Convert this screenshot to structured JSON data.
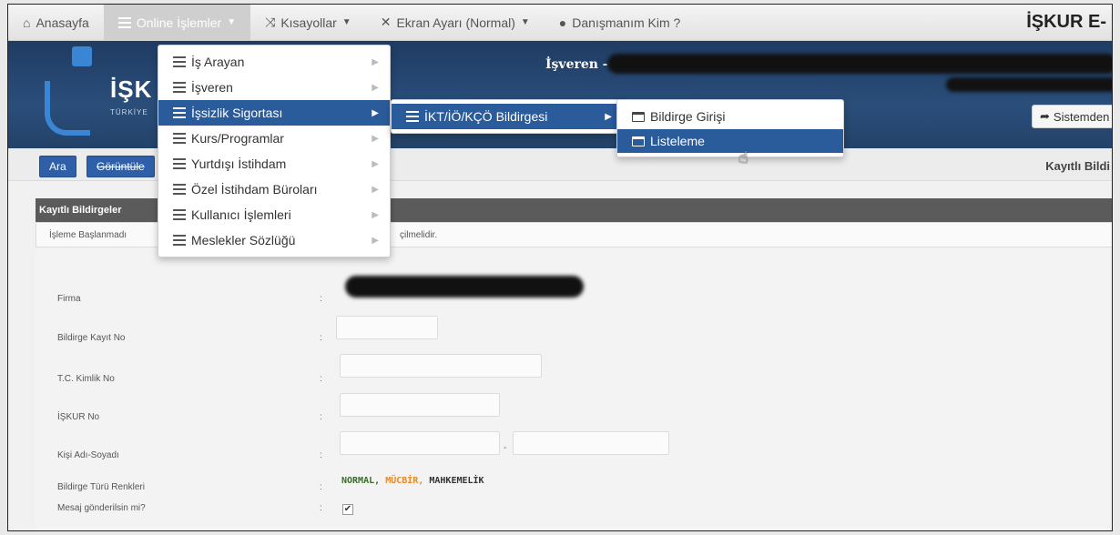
{
  "navbar": {
    "home_label": "Anasayfa",
    "online_label": "Online İşlemler",
    "shortcuts_label": "Kısayollar",
    "screen_label": "Ekran Ayarı (Normal)",
    "advisor_label": "Danışmanım Kim ?",
    "brand": "İŞKUR E-"
  },
  "header": {
    "logo_text": "İŞK",
    "logo_sub": "TÜRKİYE",
    "isveren_label": "İşveren -",
    "exit_label": "Sistemden"
  },
  "toolbar": {
    "ara_label": "Ara",
    "goruntule_label": "Görüntüle",
    "right_title": "Kayıtlı Bildi"
  },
  "panel": {
    "header": "Kayıtlı Bildirgeler",
    "notice_start": "İşleme Başlanmadı",
    "notice_end": "çilmelidir."
  },
  "form": {
    "firma_label": "Firma",
    "kayit_no_label": "Bildirge Kayıt No",
    "tc_label": "T.C. Kimlik No",
    "iskur_no_label": "İŞKUR No",
    "ad_soyad_label": "Kişi Adı-Soyadı",
    "renk_label": "Bildirge Türü Renkleri",
    "mesaj_label": "Mesaj gönderilsin mi?",
    "legend_normal": "NORMAL,",
    "legend_acil": "MÜCBİR,",
    "legend_mahkemelik": "MAHKEMELİK",
    "mesaj_checked": "✔"
  },
  "menu1": {
    "items": [
      "İş Arayan",
      "İşveren",
      "İşsizlik Sigortası",
      "Kurs/Programlar",
      "Yurtdışı İstihdam",
      "Özel İstihdam Büroları",
      "Kullanıcı İşlemleri",
      "Meslekler Sözlüğü"
    ]
  },
  "menu2": {
    "items": [
      "İKT/İÖ/KÇÖ Bildirgesi"
    ]
  },
  "menu3": {
    "items": [
      "Bildirge Girişi",
      "Listeleme"
    ]
  },
  "icons": {
    "home": "home-icon",
    "shortcuts": "shuffle-icon",
    "screen": "resize-icon",
    "advisor": "user-icon",
    "exit": "share-arrow-icon",
    "cursor": "hand-pointer-icon"
  },
  "colors": {
    "header_bg": "#2a4e7a",
    "highlight": "#2a5b9b",
    "button_blue": "#2f5fa8",
    "legend_normal": "#3b6b2b",
    "legend_acil": "#e58a2a"
  }
}
